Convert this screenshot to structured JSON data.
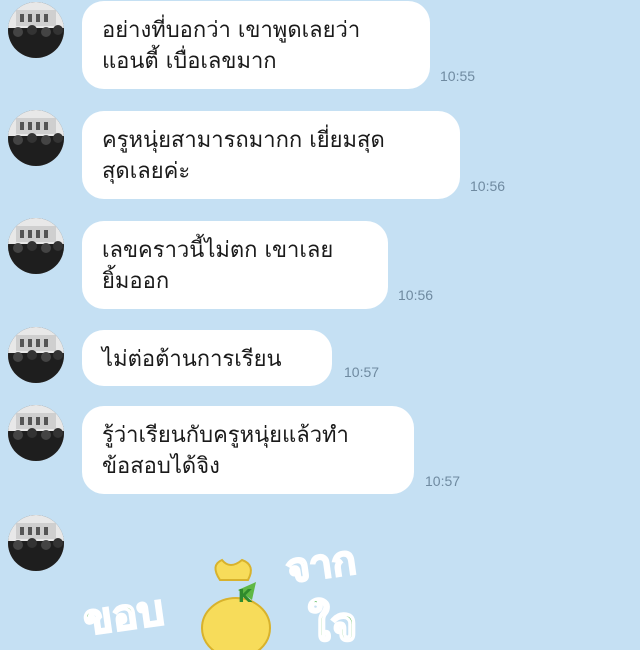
{
  "messages": [
    {
      "lines": [
        "อย่างที่บอกว่า เขาพูดเลยว่า",
        "แอนตี้ เบื่อเลขมาก"
      ],
      "time": "10:55"
    },
    {
      "lines": [
        "ครูหนุ่ยสามารถมากก เยี่ยมสุด",
        "สุดเลยค่ะ"
      ],
      "time": "10:56"
    },
    {
      "lines": [
        "เลขคราวนี้ไม่ตก เขาเลย",
        "ยิ้มออก"
      ],
      "time": "10:56"
    },
    {
      "lines": [
        "ไม่ต่อต้านการเรียน"
      ],
      "time": "10:57"
    },
    {
      "lines": [
        "รู้ว่าเรียนกับครูหนุ่ยแล้วทำ",
        "ข้อสอบได้จิง"
      ],
      "time": "10:57"
    }
  ],
  "sticker": {
    "text_left": "ขอบ",
    "text_right_top": "จาก",
    "text_right_bottom": "ใจ",
    "colors": {
      "text": "#3dab3a",
      "bag": "#f7dc5a",
      "leaf": "#5fb844"
    }
  },
  "colors": {
    "background": "#c5e0f3",
    "bubble": "#ffffff",
    "time": "#6f8aa0"
  }
}
